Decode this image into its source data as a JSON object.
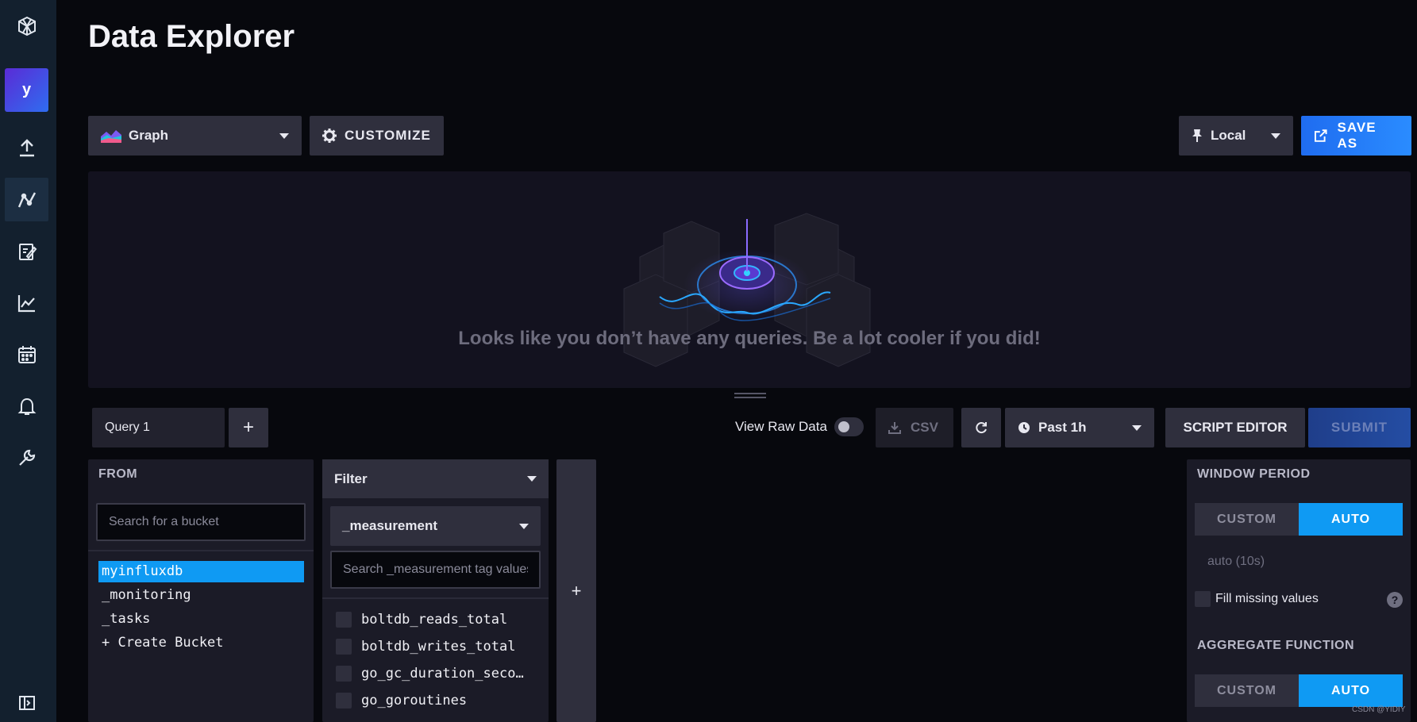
{
  "page": {
    "title": "Data Explorer"
  },
  "sidebar": {
    "avatar_letter": "y",
    "items": [
      {
        "icon": "cube-logo-icon"
      },
      {
        "icon": "upload-icon"
      },
      {
        "icon": "data-explorer-icon"
      },
      {
        "icon": "notebook-edit-icon"
      },
      {
        "icon": "dashboards-icon"
      },
      {
        "icon": "tasks-calendar-icon"
      },
      {
        "icon": "alerts-bell-icon"
      },
      {
        "icon": "settings-wrench-icon"
      },
      {
        "icon": "collapse-sidebar-icon"
      }
    ]
  },
  "toolbar": {
    "graph_label": "Graph",
    "customize_label": "CUSTOMIZE",
    "local_label": "Local",
    "save_as_label": "SAVE AS"
  },
  "graph": {
    "empty_message": "Looks like you don’t have any queries. Be a lot cooler if you did!"
  },
  "query_bar": {
    "query_tab": "Query 1",
    "add_query": "+",
    "view_raw_label": "View Raw Data",
    "view_raw_enabled": false,
    "csv_label": "CSV",
    "time_range": "Past 1h",
    "script_editor_label": "SCRIPT EDITOR",
    "submit_label": "SUBMIT"
  },
  "from_panel": {
    "header": "FROM",
    "search_placeholder": "Search for a bucket",
    "buckets": [
      "myinfluxdb",
      "_monitoring",
      "_tasks",
      "+ Create Bucket"
    ],
    "selected_bucket": "myinfluxdb"
  },
  "filter_panel": {
    "header": "Filter",
    "key": "_measurement",
    "search_placeholder": "Search _measurement tag values",
    "values": [
      "boltdb_reads_total",
      "boltdb_writes_total",
      "go_gc_duration_seco…",
      "go_goroutines"
    ]
  },
  "add_filter": {
    "label": "+"
  },
  "aggregate_panel": {
    "window_period_header": "WINDOW PERIOD",
    "custom_label": "CUSTOM",
    "auto_label": "AUTO",
    "window_value": "auto (10s)",
    "fill_missing_label": "Fill missing values",
    "help_label": "?",
    "aggregate_header": "AGGREGATE FUNCTION",
    "agg_custom_label": "CUSTOM",
    "agg_auto_label": "AUTO"
  },
  "watermark": "CSDN @YIDIY",
  "colors": {
    "background": "#07080d",
    "sidebar": "#13202e",
    "accent": "#0f9af3",
    "save_as": "#1f6cf0",
    "panel": "#1b1b27"
  }
}
